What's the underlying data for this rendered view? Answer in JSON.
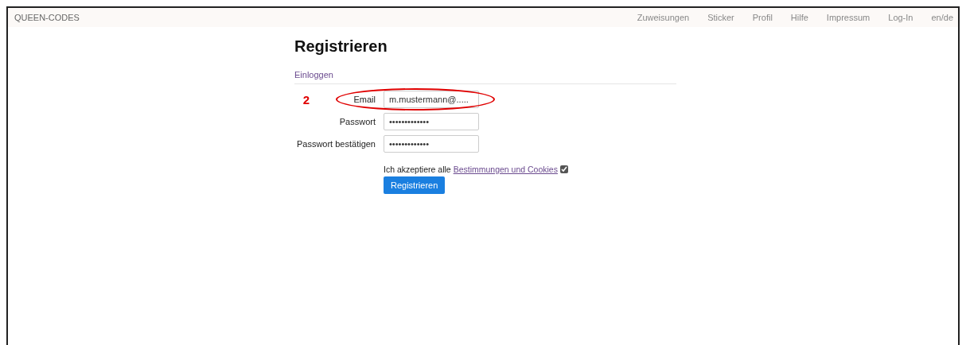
{
  "navbar": {
    "brand": "QUEEN-CODES",
    "links": [
      "Zuweisungen",
      "Sticker",
      "Profil",
      "Hilfe",
      "Impressum",
      "Log-In",
      "en/de"
    ]
  },
  "page": {
    "title": "Registrieren",
    "tab_link": "Einloggen"
  },
  "annotation": {
    "number": "2"
  },
  "fields": [
    {
      "label": "Email",
      "value": "m.mustermann@.....",
      "highlighted": true
    },
    {
      "label": "Passwort",
      "value": "•••••••••••••",
      "highlighted": false
    },
    {
      "label": "Passwort bestätigen",
      "value": "•••••••••••••",
      "highlighted": false
    }
  ],
  "terms": {
    "text": "Ich akzeptiere alle",
    "link": "Bestimmungen und Cookies",
    "checked": true
  },
  "submit": "Registrieren"
}
